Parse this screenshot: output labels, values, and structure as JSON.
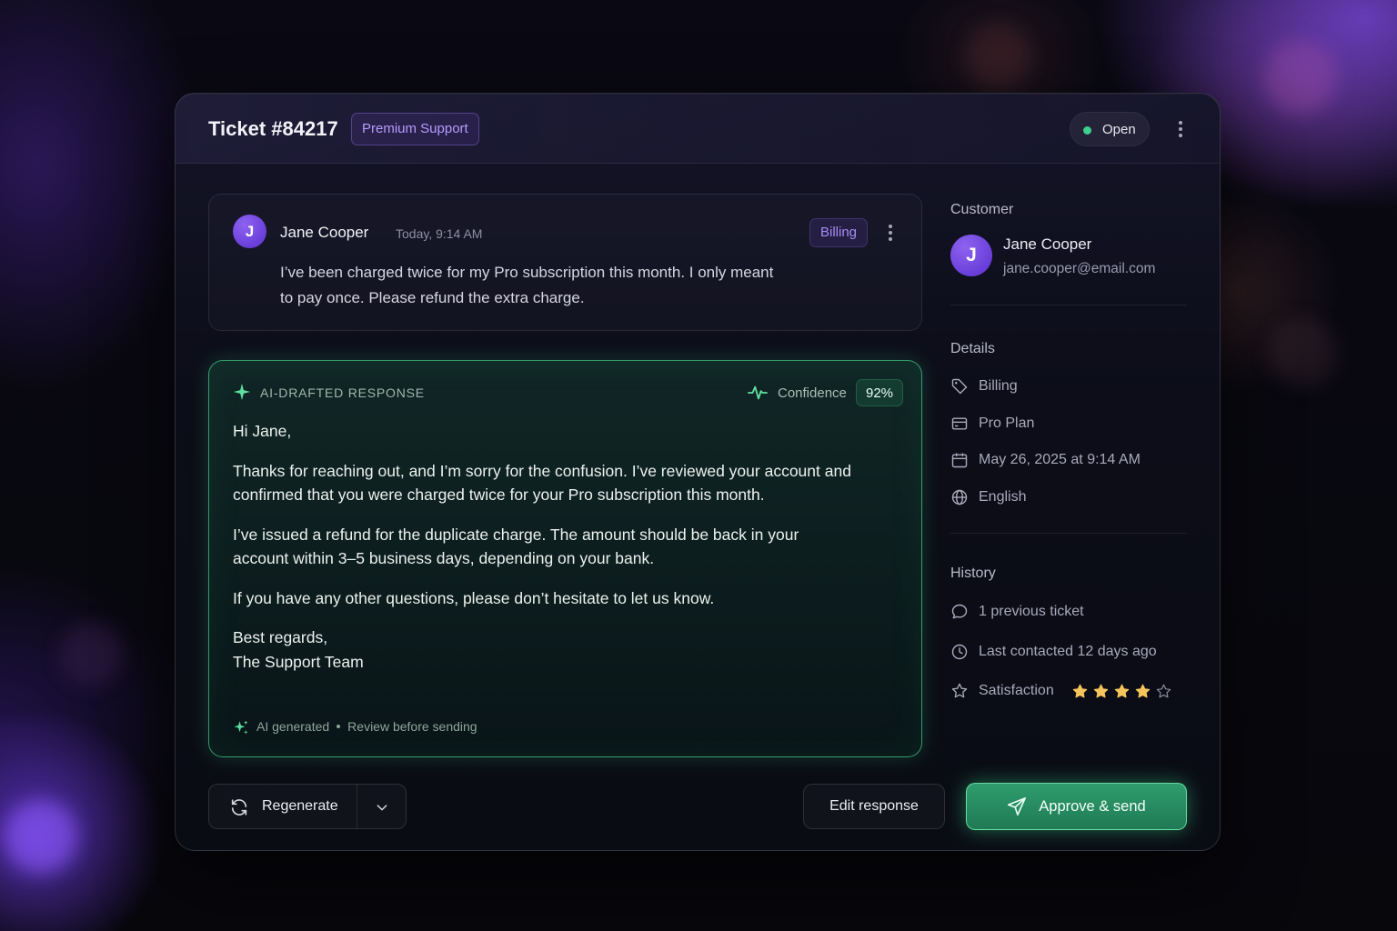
{
  "header": {
    "title": "Ticket #84217",
    "plan_badge": "Premium Support",
    "status": "Open",
    "status_color": "#3fcf8e"
  },
  "message": {
    "avatar_initial": "J",
    "sender": "Jane Cooper",
    "time": "Today, 9:14 AM",
    "tag": "Billing",
    "text": "I’ve been charged twice for my Pro subscription this month. I only meant to pay once. Please refund the extra charge."
  },
  "ai_draft": {
    "label": "AI-DRAFTED RESPONSE",
    "confidence_label": "Confidence",
    "confidence_value": "92%",
    "greeting": "Hi Jane,",
    "p1": "Thanks for reaching out, and I’m sorry for the confusion. I’ve reviewed your account and confirmed that you were charged twice for your Pro subscription this month.",
    "p2": "I’ve issued a refund for the duplicate charge. The amount should be back in your account within 3–5 business days, depending on your bank.",
    "p3": "If you have any other questions, please don’t hesitate to let us know.",
    "signoff": "Best regards,",
    "signature": "The Support Team",
    "footer_generated": "AI generated",
    "footer_review": "Review before sending",
    "accent": "#46d28c"
  },
  "sidebar": {
    "customer_heading": "Customer",
    "customer_initial": "J",
    "customer_name": "Jane Cooper",
    "customer_email": "jane.cooper@email.com",
    "details_heading": "Details",
    "details": {
      "category": "Billing",
      "plan": "Pro Plan",
      "date": "May 26, 2025 at 9:14 AM",
      "language": "English"
    },
    "history_heading": "History",
    "history": {
      "previous": "1 previous ticket",
      "last_contacted": "Last contacted 12 days ago",
      "satisfaction_label": "Satisfaction",
      "satisfaction_rating": 4,
      "satisfaction_max": 5
    },
    "star_color": "#f5c45a"
  },
  "actions": {
    "regenerate": "Regenerate",
    "edit": "Edit response",
    "approve": "Approve & send"
  }
}
